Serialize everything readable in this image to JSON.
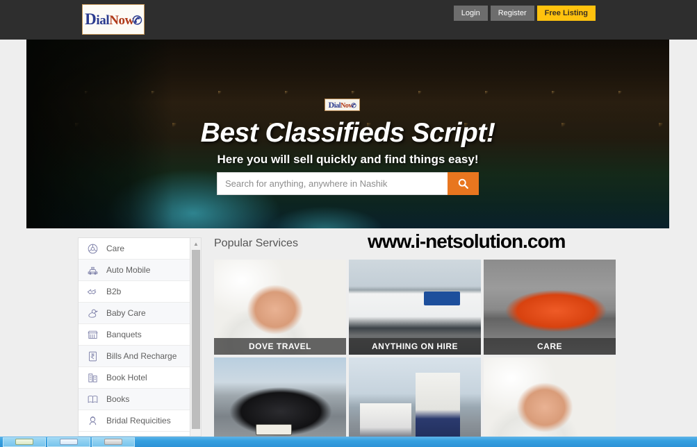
{
  "header": {
    "logo": {
      "part1": "D",
      "part2": "ial",
      "part3": "Now",
      "icon": "phone-signal-icon"
    },
    "nav": [
      {
        "label": "Login",
        "name": "login-button"
      },
      {
        "label": "Register",
        "name": "register-button"
      },
      {
        "label": "Free Listing",
        "name": "free-listing-button"
      }
    ],
    "accent_color": "#ffc20e",
    "background_color": "#2e2e2e"
  },
  "hero": {
    "title": "Best Classifieds Script!",
    "subtitle": "Here you will sell quickly and find things easy!",
    "badge_logo": {
      "part1": "D",
      "part2": "ial",
      "part3": "Now"
    },
    "search": {
      "placeholder": "Search for anything, anywhere in Nashik",
      "value": "",
      "button_icon": "search-icon",
      "button_color": "#e8761f"
    },
    "carousel": {
      "total": 3,
      "active_index": 1
    }
  },
  "sidebar": {
    "items": [
      {
        "label": "Care",
        "icon": "wheel-icon"
      },
      {
        "label": "Auto Mobile",
        "icon": "taxi-icon"
      },
      {
        "label": "B2b",
        "icon": "handshake-icon"
      },
      {
        "label": "Baby Care",
        "icon": "duck-icon"
      },
      {
        "label": "Banquets",
        "icon": "storefront-icon"
      },
      {
        "label": "Bills And Recharge",
        "icon": "rupee-note-icon"
      },
      {
        "label": "Book Hotel",
        "icon": "building-icon"
      },
      {
        "label": "Books",
        "icon": "books-icon"
      },
      {
        "label": "Bridal Requicities",
        "icon": "bride-icon"
      }
    ],
    "scrollbar": {
      "up_arrow": "▲"
    }
  },
  "main": {
    "section_title": "Popular Services",
    "watermark": "www.i-netsolution.com",
    "cards": [
      {
        "caption": "DOVE TRAVEL",
        "photo": "ph-baby"
      },
      {
        "caption": "ANYTHING ON HIRE",
        "photo": "ph-bus"
      },
      {
        "caption": "CARE",
        "photo": "ph-car-orange"
      },
      {
        "caption": "",
        "photo": "ph-car-black"
      },
      {
        "caption": "",
        "photo": "ph-printer"
      },
      {
        "caption": "",
        "photo": "ph-baby"
      }
    ]
  },
  "taskbar": {
    "buttons": [
      {
        "name": "taskbar-item-1"
      },
      {
        "name": "taskbar-item-2"
      },
      {
        "name": "taskbar-item-3"
      }
    ]
  }
}
